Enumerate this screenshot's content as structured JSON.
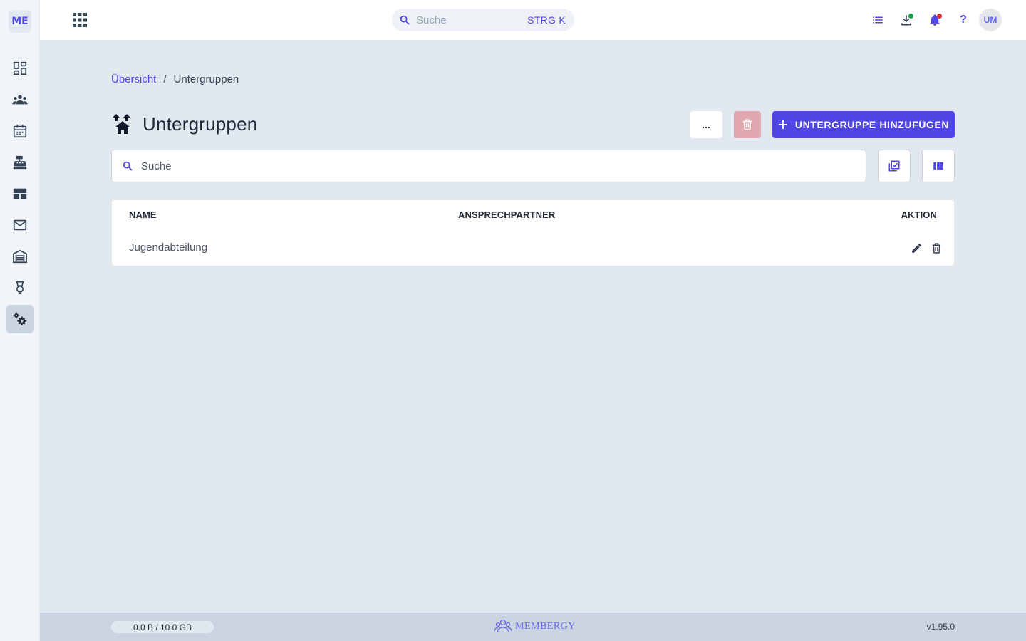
{
  "sidebar": {
    "logo": "ME",
    "items": [
      {
        "name": "dashboard",
        "icon": "dashboard-icon"
      },
      {
        "name": "members",
        "icon": "groups-icon"
      },
      {
        "name": "calendar",
        "icon": "calendar-icon"
      },
      {
        "name": "cashbox",
        "icon": "cash-register-icon"
      },
      {
        "name": "tables",
        "icon": "table-rows-icon"
      },
      {
        "name": "mail",
        "icon": "mail-icon"
      },
      {
        "name": "warehouse",
        "icon": "warehouse-icon"
      },
      {
        "name": "awards",
        "icon": "award-icon"
      },
      {
        "name": "settings",
        "icon": "settings-icon",
        "active": true
      }
    ]
  },
  "topbar": {
    "search_placeholder": "Suche",
    "search_shortcut": "STRG K",
    "help_label": "?",
    "avatar_initials": "UM",
    "download_badge_color": "#16a34a",
    "notification_badge_color": "#dc2626"
  },
  "breadcrumb": {
    "root": "Übersicht",
    "separator": "/",
    "current": "Untergruppen"
  },
  "page": {
    "title": "Untergruppen",
    "more_label": "...",
    "add_label": "UNTERGRUPPE HINZUFÜGEN",
    "search_placeholder": "Suche"
  },
  "table": {
    "columns": [
      "NAME",
      "ANSPRECHPARTNER",
      "AKTION"
    ],
    "rows": [
      {
        "name": "Jugendabteilung",
        "contact": ""
      }
    ]
  },
  "footer": {
    "storage": "0.0 B / 10.0 GB",
    "brand": "MEMBERGY",
    "version": "v1.95.0"
  },
  "colors": {
    "accent": "#4f46e5",
    "danger_disabled": "#e0a9b0"
  }
}
